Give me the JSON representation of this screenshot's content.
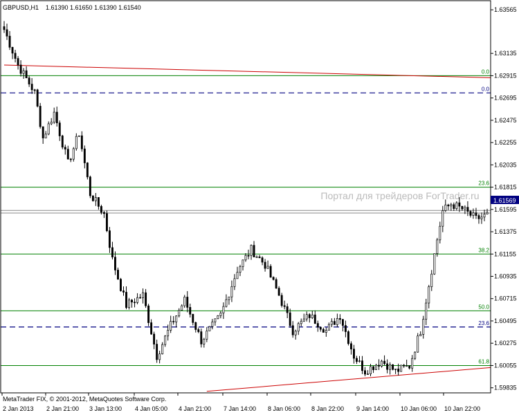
{
  "header": {
    "symbol_timeframe": "GBPUSD,H1",
    "ohlc": "1.61390 1.61650 1.61390 1.61540"
  },
  "watermark": "Портал для трейдеров ForTrader.ru",
  "copyright": "MetaTrader FIX, © 2001-2012, MetaQuotes Software Corp.",
  "current_price": "1.61569",
  "colors": {
    "background": "#ffffff",
    "candle": "#000000",
    "fib_level": "#008000",
    "fib_zero_dashed": "#000080",
    "trendline": "#cc0000",
    "price_tag_bg": "#000080",
    "watermark": "#bbbbbb"
  },
  "chart_data": {
    "type": "candlestick",
    "y_ticks": [
      "1.63565",
      "1.63135",
      "1.62915",
      "1.62695",
      "1.62475",
      "1.62255",
      "1.62035",
      "1.61815",
      "1.61595",
      "1.61375",
      "1.61155",
      "1.60935",
      "1.60715",
      "1.60495",
      "1.60275",
      "1.60055",
      "1.59835"
    ],
    "x_ticks": [
      "2 Jan 2013",
      "2 Jan 21:00",
      "3 Jan 13:00",
      "4 Jan 05:00",
      "4 Jan 21:00",
      "7 Jan 14:00",
      "8 Jan 06:00",
      "8 Jan 22:00",
      "9 Jan 14:00",
      "10 Jan 06:00",
      "10 Jan 22:00"
    ],
    "ylim": [
      1.59785,
      1.63655
    ],
    "fib_levels": [
      {
        "label": "0.0",
        "price": 1.62915,
        "style": "solid"
      },
      {
        "label": "0.0",
        "price": 1.62745,
        "style": "dashed"
      },
      {
        "label": "23.6",
        "price": 1.61815,
        "style": "solid"
      },
      {
        "label": "38.2",
        "price": 1.61155,
        "style": "solid"
      },
      {
        "label": "50.0",
        "price": 1.60595,
        "style": "solid"
      },
      {
        "label": "23.6",
        "price": 1.60435,
        "style": "dashed"
      },
      {
        "label": "61.8",
        "price": 1.60055,
        "style": "solid"
      }
    ],
    "horizontal_lines": [
      1.61585,
      1.6156
    ],
    "trendlines": [
      {
        "from": {
          "bar": 0,
          "price": 1.6302
        },
        "to": {
          "bar": 176,
          "price": 1.62895
        }
      },
      {
        "from": {
          "bar": 73,
          "price": 1.598
        },
        "to": {
          "bar": 176,
          "price": 1.60035
        }
      }
    ],
    "anchors": [
      {
        "bar": 0,
        "value": 1.6337
      },
      {
        "bar": 5,
        "value": 1.6302
      },
      {
        "bar": 11,
        "value": 1.6275
      },
      {
        "bar": 14,
        "value": 1.623
      },
      {
        "bar": 18,
        "value": 1.6255
      },
      {
        "bar": 23,
        "value": 1.6205
      },
      {
        "bar": 27,
        "value": 1.6235
      },
      {
        "bar": 31,
        "value": 1.6175
      },
      {
        "bar": 36,
        "value": 1.6155
      },
      {
        "bar": 39,
        "value": 1.611
      },
      {
        "bar": 44,
        "value": 1.6065
      },
      {
        "bar": 50,
        "value": 1.6075
      },
      {
        "bar": 55,
        "value": 1.6015
      },
      {
        "bar": 60,
        "value": 1.6045
      },
      {
        "bar": 65,
        "value": 1.607
      },
      {
        "bar": 71,
        "value": 1.603
      },
      {
        "bar": 78,
        "value": 1.6055
      },
      {
        "bar": 84,
        "value": 1.61
      },
      {
        "bar": 89,
        "value": 1.612
      },
      {
        "bar": 94,
        "value": 1.6105
      },
      {
        "bar": 99,
        "value": 1.6075
      },
      {
        "bar": 104,
        "value": 1.604
      },
      {
        "bar": 110,
        "value": 1.6055
      },
      {
        "bar": 116,
        "value": 1.604
      },
      {
        "bar": 121,
        "value": 1.6055
      },
      {
        "bar": 126,
        "value": 1.6015
      },
      {
        "bar": 130,
        "value": 1.6
      },
      {
        "bar": 136,
        "value": 1.601
      },
      {
        "bar": 141,
        "value": 1.6
      },
      {
        "bar": 146,
        "value": 1.6005
      },
      {
        "bar": 150,
        "value": 1.604
      },
      {
        "bar": 153,
        "value": 1.6085
      },
      {
        "bar": 156,
        "value": 1.613
      },
      {
        "bar": 158,
        "value": 1.6158
      },
      {
        "bar": 161,
        "value": 1.6165
      },
      {
        "bar": 165,
        "value": 1.616
      },
      {
        "bar": 170,
        "value": 1.615
      },
      {
        "bar": 174,
        "value": 1.6154
      }
    ],
    "n_bars": 175
  }
}
